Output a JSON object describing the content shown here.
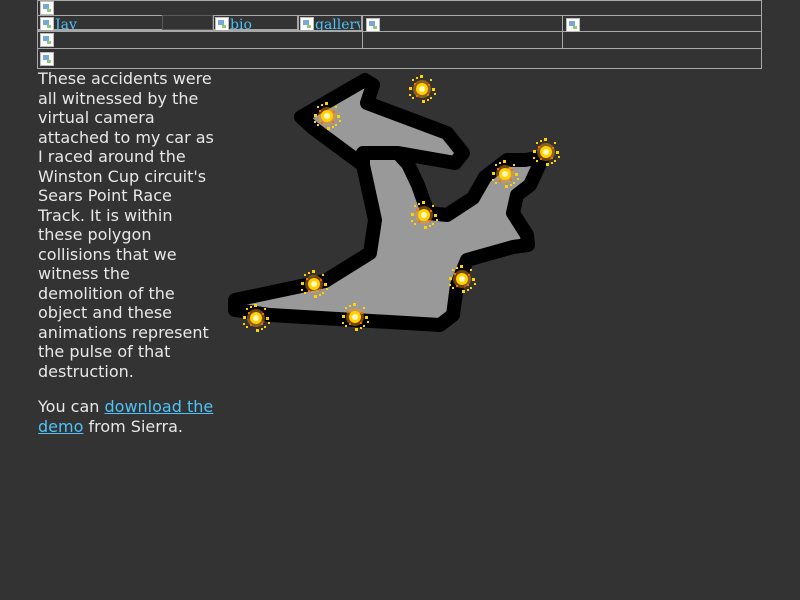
{
  "nav": {
    "jay": "Jay",
    "bio": "bio",
    "gallery": "gallery"
  },
  "content": {
    "para1": "These accidents were all witnessed by the virtual camera attached to my car as I raced around the Winston Cup circuit's Sears Point Race Track. It is within these polygon collisions that we witness the demolition of the object and these animations represent the pulse of that destruction.",
    "para2_prefix": "You can ",
    "download_link": "download the demo",
    "para2_suffix": " from Sierra."
  },
  "colors": {
    "background": "#333333",
    "text": "#e6e6e6",
    "link": "#4fc3f7",
    "track_fill": "#999999",
    "track_border": "#000000",
    "spark": "#ffd200"
  }
}
